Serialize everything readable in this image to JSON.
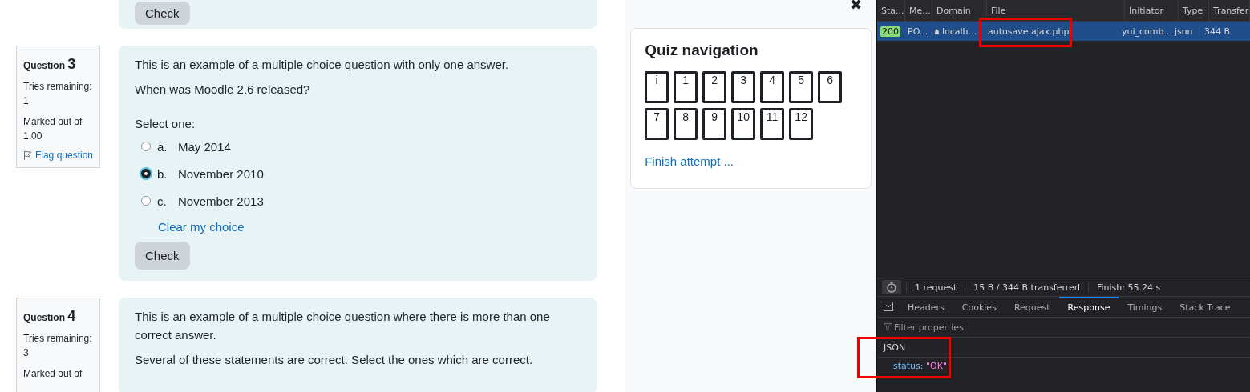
{
  "previous_question": {
    "check_button": "Check"
  },
  "questions": [
    {
      "label": "Question",
      "number": "3",
      "tries_label": "Tries remaining:",
      "tries": "1",
      "marked_label": "Marked out of",
      "marked": "1.00",
      "flag": "Flag question",
      "text": [
        "This is an example of a multiple choice question with only one answer.",
        "When was Moodle 2.6 released?"
      ],
      "prompt": "Select one:",
      "options": [
        {
          "letter": "a.",
          "text": "May 2014",
          "selected": false
        },
        {
          "letter": "b.",
          "text": "November 2010",
          "selected": true
        },
        {
          "letter": "c.",
          "text": "November 2013",
          "selected": false
        }
      ],
      "clear": "Clear my choice",
      "check_button": "Check"
    },
    {
      "label": "Question",
      "number": "4",
      "tries_label": "Tries remaining:",
      "tries": "3",
      "marked_label": "Marked out of",
      "text": [
        "This is an example of a multiple choice question where there is more than one correct answer.",
        "Several of these statements are correct. Select the ones which are correct."
      ]
    }
  ],
  "drawer": {
    "close": "✖",
    "title": "Quiz navigation",
    "rows": [
      [
        "i",
        "1",
        "2",
        "3",
        "4",
        "5",
        "6"
      ],
      [
        "7",
        "8",
        "9",
        "10",
        "11",
        "12"
      ]
    ],
    "finish": "Finish attempt ..."
  },
  "devtools": {
    "columns": [
      "Sta...",
      "Me...",
      "Domain",
      "File",
      "Initiator",
      "Type",
      "Transfer"
    ],
    "requests": [
      {
        "status": "200",
        "method": "PO...",
        "domain": "localh...",
        "file": "autosave.ajax.php",
        "initiator": "yui_comb...",
        "type": "json",
        "transferred": "344 B",
        "selected": true
      }
    ],
    "summary": [
      "1 request",
      "15 B / 344 B transferred",
      "Finish: 55.24 s"
    ],
    "tabs": [
      {
        "label": "Headers",
        "selected": false
      },
      {
        "label": "Cookies",
        "selected": false
      },
      {
        "label": "Request",
        "selected": false
      },
      {
        "label": "Response",
        "selected": true
      },
      {
        "label": "Timings",
        "selected": false
      },
      {
        "label": "Stack Trace",
        "selected": false
      }
    ],
    "filter": {
      "placeholder": "Filter properties"
    },
    "json_heading": "JSON",
    "response": [
      {
        "key": "status:",
        "value": "\"OK\""
      }
    ]
  }
}
